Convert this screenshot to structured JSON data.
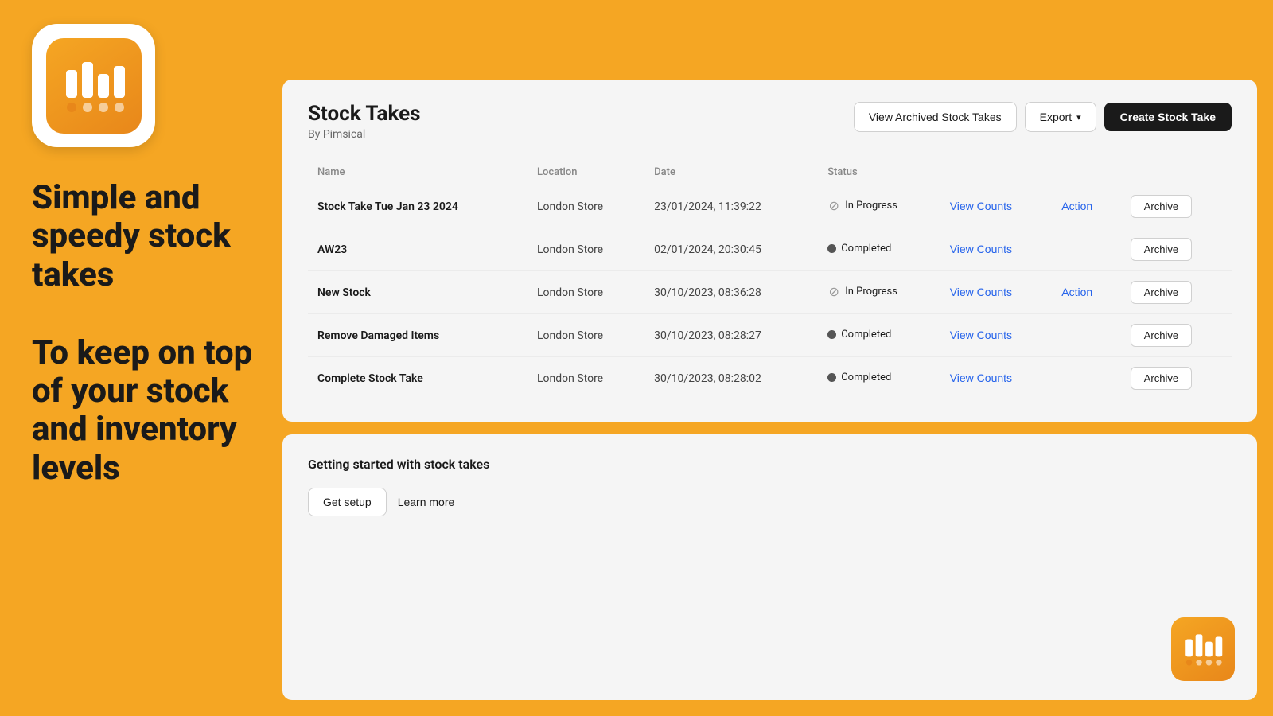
{
  "page": {
    "background_color": "#F5A623"
  },
  "left_panel": {
    "hero_text_1": "Simple and speedy stock takes",
    "hero_text_2": "To keep on top of your stock and inventory levels"
  },
  "header": {
    "title": "Stock Takes",
    "subtitle": "By Pimsical",
    "view_archived_label": "View Archived Stock Takes",
    "export_label": "Export",
    "create_label": "Create Stock Take"
  },
  "table": {
    "columns": [
      "Name",
      "Location",
      "Date",
      "Status",
      "",
      "",
      ""
    ],
    "rows": [
      {
        "name": "Stock Take Tue Jan 23 2024",
        "location": "London Store",
        "date": "23/01/2024, 11:39:22",
        "status": "In Progress",
        "status_type": "in-progress",
        "has_action": true
      },
      {
        "name": "AW23",
        "location": "London Store",
        "date": "02/01/2024, 20:30:45",
        "status": "Completed",
        "status_type": "completed",
        "has_action": false
      },
      {
        "name": "New Stock",
        "location": "London Store",
        "date": "30/10/2023, 08:36:28",
        "status": "In Progress",
        "status_type": "in-progress",
        "has_action": true
      },
      {
        "name": "Remove Damaged Items",
        "location": "London Store",
        "date": "30/10/2023, 08:28:27",
        "status": "Completed",
        "status_type": "completed",
        "has_action": false
      },
      {
        "name": "Complete Stock Take",
        "location": "London Store",
        "date": "30/10/2023, 08:28:02",
        "status": "Completed",
        "status_type": "completed",
        "has_action": false
      }
    ],
    "view_counts_label": "View Counts",
    "action_label": "Action",
    "archive_label": "Archive"
  },
  "getting_started": {
    "title": "Getting started with stock takes",
    "setup_label": "Get setup",
    "learn_label": "Learn more"
  }
}
